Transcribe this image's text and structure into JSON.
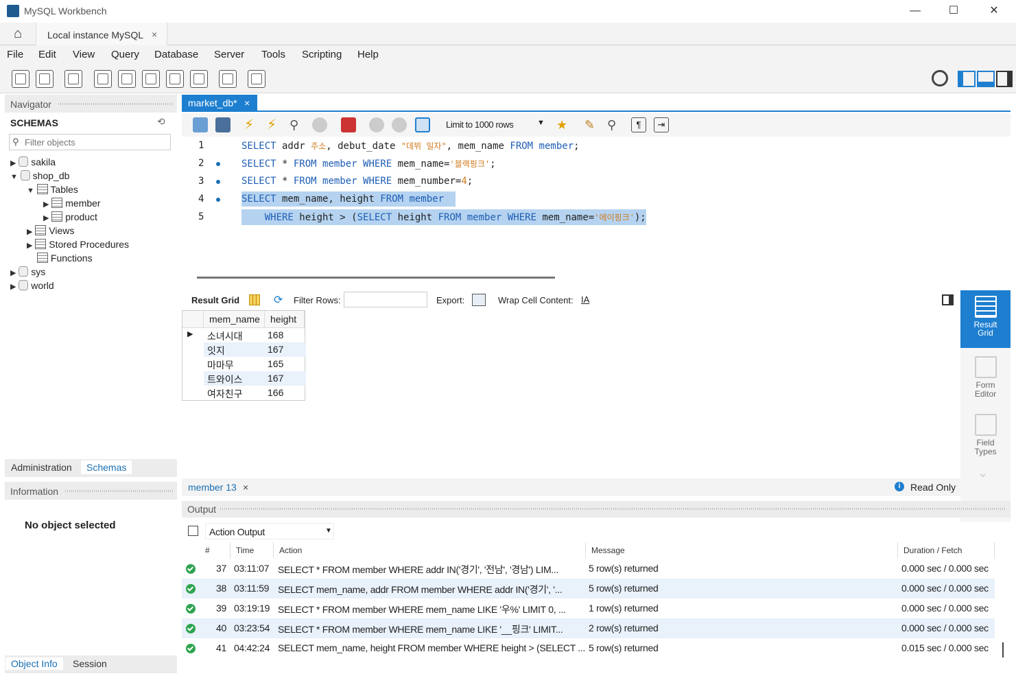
{
  "window": {
    "title": "MySQL Workbench",
    "minimize": "—",
    "maximize": "☐",
    "close": "✕"
  },
  "tabs": {
    "connection_label": "Local instance MySQL",
    "close": "×"
  },
  "menu": [
    "File",
    "Edit",
    "View",
    "Query",
    "Database",
    "Server",
    "Tools",
    "Scripting",
    "Help"
  ],
  "navigator": {
    "title": "Navigator",
    "schemas_label": "SCHEMAS",
    "filter_placeholder": "Filter objects",
    "tree": {
      "sakila": "sakila",
      "shop_db": "shop_db",
      "tables": "Tables",
      "member": "member",
      "product": "product",
      "views": "Views",
      "procs": "Stored Procedures",
      "functions": "Functions",
      "sys": "sys",
      "world": "world"
    },
    "tab_admin": "Administration",
    "tab_schemas": "Schemas",
    "info_title": "Information",
    "no_object": "No object selected",
    "tab_object_info": "Object Info",
    "tab_session": "Session"
  },
  "query_tab": {
    "label": "market_db*",
    "close": "×"
  },
  "query_toolbar": {
    "limit": "Limit to 1000 rows"
  },
  "editor": {
    "lines": [
      {
        "num": "1"
      },
      {
        "num": "2"
      },
      {
        "num": "3"
      },
      {
        "num": "4"
      },
      {
        "num": "5"
      }
    ],
    "l1": {
      "a": "SELECT",
      "b": " addr ",
      "c": "주소",
      "d": ", debut_date ",
      "e": "\"데뷔 일자\"",
      "f": ", mem_name ",
      "g": "FROM",
      "h": " ",
      "i": "member",
      "j": ";"
    },
    "l2": {
      "a": "SELECT",
      "b": " * ",
      "c": "FROM",
      "d": " ",
      "e": "member",
      "f": " ",
      "g": "WHERE",
      "h": " mem_name=",
      "i": "'블랙핑크'",
      "j": ";"
    },
    "l3": {
      "a": "SELECT",
      "b": " * ",
      "c": "FROM",
      "d": " ",
      "e": "member",
      "f": " ",
      "g": "WHERE",
      "h": " mem_number=",
      "i": "4",
      "j": ";"
    },
    "l4": {
      "a": "SELECT",
      "b": " mem_name, height ",
      "c": "FROM",
      "d": " ",
      "e": "member"
    },
    "l5": {
      "a": "    WHERE",
      "b": " height > (",
      "c": "SELECT",
      "d": " height ",
      "e": "FROM",
      "f": " ",
      "g": "member",
      "h": " ",
      "i": "WHERE",
      "j": " mem_name=",
      "k": "'에이핑크'",
      "l": ");"
    }
  },
  "result_toolbar": {
    "result_grid": "Result Grid",
    "filter_rows": "Filter Rows:",
    "export": "Export:",
    "wrap": "Wrap Cell Content:"
  },
  "result_grid": {
    "columns": [
      "mem_name",
      "height"
    ],
    "rows": [
      {
        "mem_name": "소녀시대",
        "height": "168"
      },
      {
        "mem_name": "잇지",
        "height": "167"
      },
      {
        "mem_name": "마마무",
        "height": "165"
      },
      {
        "mem_name": "트와이스",
        "height": "167"
      },
      {
        "mem_name": "여자친구",
        "height": "166"
      }
    ]
  },
  "right_panel": {
    "result_grid": "Result Grid",
    "form_editor": "Form Editor",
    "field_types": "Field Types"
  },
  "result_status": {
    "tab": "member 13",
    "close": "×",
    "readonly": "Read Only"
  },
  "output": {
    "title": "Output",
    "selector": "Action Output",
    "columns": {
      "num": "#",
      "time": "Time",
      "action": "Action",
      "message": "Message",
      "duration": "Duration / Fetch"
    },
    "rows": [
      {
        "num": "37",
        "time": "03:11:07",
        "action": "SELECT *     FROM member     WHERE addr IN('경기', '전남', '경남') LIM...",
        "message": "5 row(s) returned",
        "duration": "0.000 sec / 0.000 sec"
      },
      {
        "num": "38",
        "time": "03:11:59",
        "action": "SELECT mem_name, addr     FROM member     WHERE addr IN('경기', '...",
        "message": "5 row(s) returned",
        "duration": "0.000 sec / 0.000 sec"
      },
      {
        "num": "39",
        "time": "03:19:19",
        "action": "SELECT *     FROM member     WHERE mem_name LIKE '우%' LIMIT 0, ...",
        "message": "1 row(s) returned",
        "duration": "0.000 sec / 0.000 sec"
      },
      {
        "num": "40",
        "time": "03:23:54",
        "action": "SELECT *     FROM member     WHERE mem_name LIKE '__핑크' LIMIT...",
        "message": "2 row(s) returned",
        "duration": "0.000 sec / 0.000 sec"
      },
      {
        "num": "41",
        "time": "04:42:24",
        "action": "SELECT mem_name, height FROM member WHERE height > (SELECT ...",
        "message": "5 row(s) returned",
        "duration": "0.015 sec / 0.000 sec"
      }
    ]
  },
  "colors": {
    "accent": "#1e7fd0",
    "keyword": "#1e5eb5",
    "string": "#d07a1e",
    "selection": "#b5d3f0",
    "ok": "#2ea44f"
  }
}
